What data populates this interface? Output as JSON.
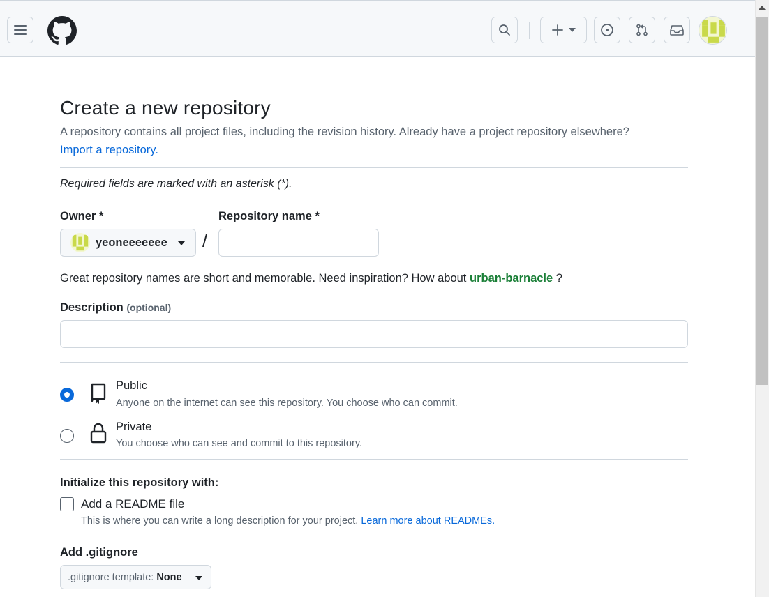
{
  "header": {
    "menu_icon": "hamburger-menu-icon",
    "logo_icon": "github-logo-icon",
    "search_icon": "search-icon",
    "create_icon": "plus-icon",
    "issues_icon": "issue-opened-icon",
    "pulls_icon": "git-pull-request-icon",
    "inbox_icon": "inbox-icon",
    "avatar_colors": [
      "#c9d94a",
      "#f3f7d1"
    ]
  },
  "page": {
    "title": "Create a new repository",
    "subtitle": "A repository contains all project files, including the revision history. Already have a project repository elsewhere?",
    "import_link": "Import a repository.",
    "required_note": "Required fields are marked with an asterisk (*)."
  },
  "owner": {
    "label": "Owner *",
    "value": "yeoneeeeeee"
  },
  "repo_name": {
    "label": "Repository name *",
    "value": "",
    "slash": "/"
  },
  "hint": {
    "prefix": "Great repository names are short and memorable. Need inspiration? How about",
    "suggestion": "urban-barnacle",
    "suffix": "?"
  },
  "description": {
    "label": "Description",
    "optional": "(optional)",
    "value": ""
  },
  "visibility": {
    "public": {
      "title": "Public",
      "desc": "Anyone on the internet can see this repository. You choose who can commit.",
      "selected": true
    },
    "private": {
      "title": "Private",
      "desc": "You choose who can see and commit to this repository.",
      "selected": false
    }
  },
  "init": {
    "label": "Initialize this repository with:",
    "readme_label": "Add a README file",
    "readme_checked": false,
    "readme_desc": "This is where you can write a long description for your project.",
    "readme_link": "Learn more about READMEs."
  },
  "gitignore": {
    "label": "Add .gitignore",
    "prefix": ".gitignore template:",
    "value": "None"
  },
  "colors": {
    "accent": "#0969da",
    "success": "#1a7f37",
    "border": "#d0d7de"
  }
}
